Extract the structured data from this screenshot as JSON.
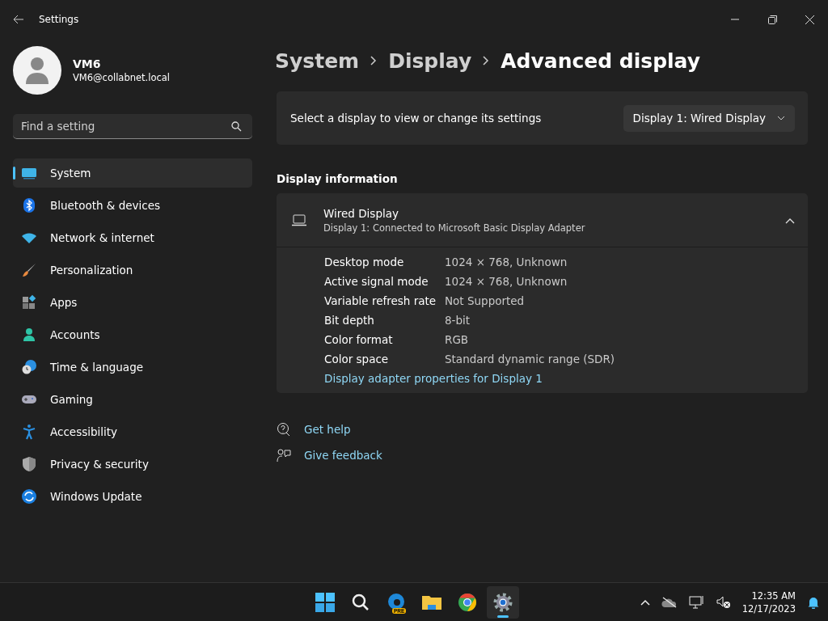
{
  "window": {
    "title": "Settings"
  },
  "account": {
    "name": "VM6",
    "email": "VM6@collabnet.local"
  },
  "search": {
    "placeholder": "Find a setting"
  },
  "nav": [
    {
      "label": "System",
      "selected": true
    },
    {
      "label": "Bluetooth & devices",
      "selected": false
    },
    {
      "label": "Network & internet",
      "selected": false
    },
    {
      "label": "Personalization",
      "selected": false
    },
    {
      "label": "Apps",
      "selected": false
    },
    {
      "label": "Accounts",
      "selected": false
    },
    {
      "label": "Time & language",
      "selected": false
    },
    {
      "label": "Gaming",
      "selected": false
    },
    {
      "label": "Accessibility",
      "selected": false
    },
    {
      "label": "Privacy & security",
      "selected": false
    },
    {
      "label": "Windows Update",
      "selected": false
    }
  ],
  "breadcrumb": [
    "System",
    "Display",
    "Advanced display"
  ],
  "display_select": {
    "label": "Select a display to view or change its settings",
    "value": "Display 1: Wired Display"
  },
  "section_title": "Display information",
  "display_card": {
    "title": "Wired Display",
    "subtitle": "Display 1: Connected to Microsoft Basic Display Adapter",
    "expanded": true,
    "rows": [
      {
        "label": "Desktop mode",
        "value": "1024 × 768, Unknown"
      },
      {
        "label": "Active signal mode",
        "value": "1024 × 768, Unknown"
      },
      {
        "label": "Variable refresh rate",
        "value": "Not Supported"
      },
      {
        "label": "Bit depth",
        "value": "8-bit"
      },
      {
        "label": "Color format",
        "value": "RGB"
      },
      {
        "label": "Color space",
        "value": "Standard dynamic range (SDR)"
      }
    ],
    "link": "Display adapter properties for Display 1"
  },
  "help_links": [
    "Get help",
    "Give feedback"
  ],
  "taskbar": {
    "badge": "PRE",
    "time": "12:35 AM",
    "date": "12/17/2023"
  }
}
